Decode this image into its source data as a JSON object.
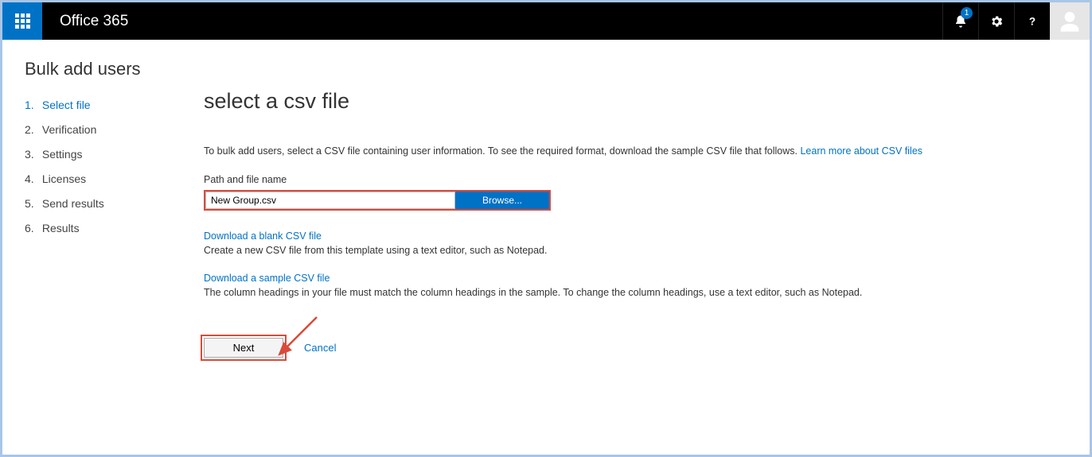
{
  "header": {
    "brand": "Office 365",
    "notification_count": "1"
  },
  "sidebar": {
    "title": "Bulk add users",
    "steps": [
      {
        "num": "1.",
        "label": "Select file",
        "active": true
      },
      {
        "num": "2.",
        "label": "Verification",
        "active": false
      },
      {
        "num": "3.",
        "label": "Settings",
        "active": false
      },
      {
        "num": "4.",
        "label": "Licenses",
        "active": false
      },
      {
        "num": "5.",
        "label": "Send results",
        "active": false
      },
      {
        "num": "6.",
        "label": "Results",
        "active": false
      }
    ]
  },
  "main": {
    "heading": "select a csv file",
    "description_pre": "To bulk add users, select a CSV file containing user information. To see the required format, download the sample CSV file that follows. ",
    "description_link": "Learn more about CSV files",
    "field_label": "Path and file name",
    "file_value": "New Group.csv",
    "browse_label": "Browse...",
    "blank_link": "Download a blank CSV file",
    "blank_hint": "Create a new CSV file from this template using a text editor, such as Notepad.",
    "sample_link": "Download a sample CSV file",
    "sample_hint": "The column headings in your file must match the column headings in the sample. To change the column headings, use a text editor, such as Notepad.",
    "next_label": "Next",
    "cancel_label": "Cancel"
  }
}
